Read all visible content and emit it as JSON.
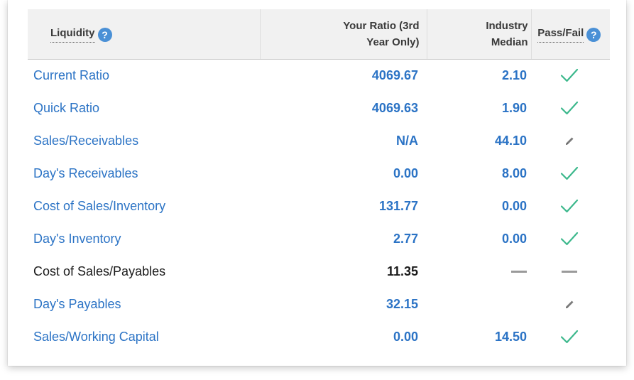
{
  "table": {
    "headers": {
      "label": "Liquidity",
      "ratio_line1": "Your Ratio (3rd",
      "ratio_line2": "Year Only)",
      "median_line1": "Industry",
      "median_line2": "Median",
      "pass": "Pass/Fail"
    },
    "rows": [
      {
        "label": "Current Ratio",
        "ratio": "4069.67",
        "median": "2.10",
        "status": "check"
      },
      {
        "label": "Quick Ratio",
        "ratio": "4069.63",
        "median": "1.90",
        "status": "check"
      },
      {
        "label": "Sales/Receivables",
        "ratio": "N/A",
        "median": "44.10",
        "status": "pencil"
      },
      {
        "label": "Day's Receivables",
        "ratio": "0.00",
        "median": "8.00",
        "status": "check"
      },
      {
        "label": "Cost of Sales/Inventory",
        "ratio": "131.77",
        "median": "0.00",
        "status": "check"
      },
      {
        "label": "Day's Inventory",
        "ratio": "2.77",
        "median": "0.00",
        "status": "check"
      },
      {
        "label": "Cost of Sales/Payables",
        "ratio": "11.35",
        "median": "",
        "status": "dash"
      },
      {
        "label": "Day's Payables",
        "ratio": "32.15",
        "median": "",
        "status": "pencil"
      },
      {
        "label": "Sales/Working Capital",
        "ratio": "0.00",
        "median": "14.50",
        "status": "check"
      }
    ]
  },
  "icons": {
    "help": "question-mark-icon",
    "pass": "checkmark-icon",
    "not_applicable": "pencil-icon",
    "no_data": "dash-icon"
  },
  "colors": {
    "link_blue": "#2b73c5",
    "check_green": "#3cb88c",
    "help_blue": "#4a90d6",
    "header_bg": "#f1f1f1"
  }
}
